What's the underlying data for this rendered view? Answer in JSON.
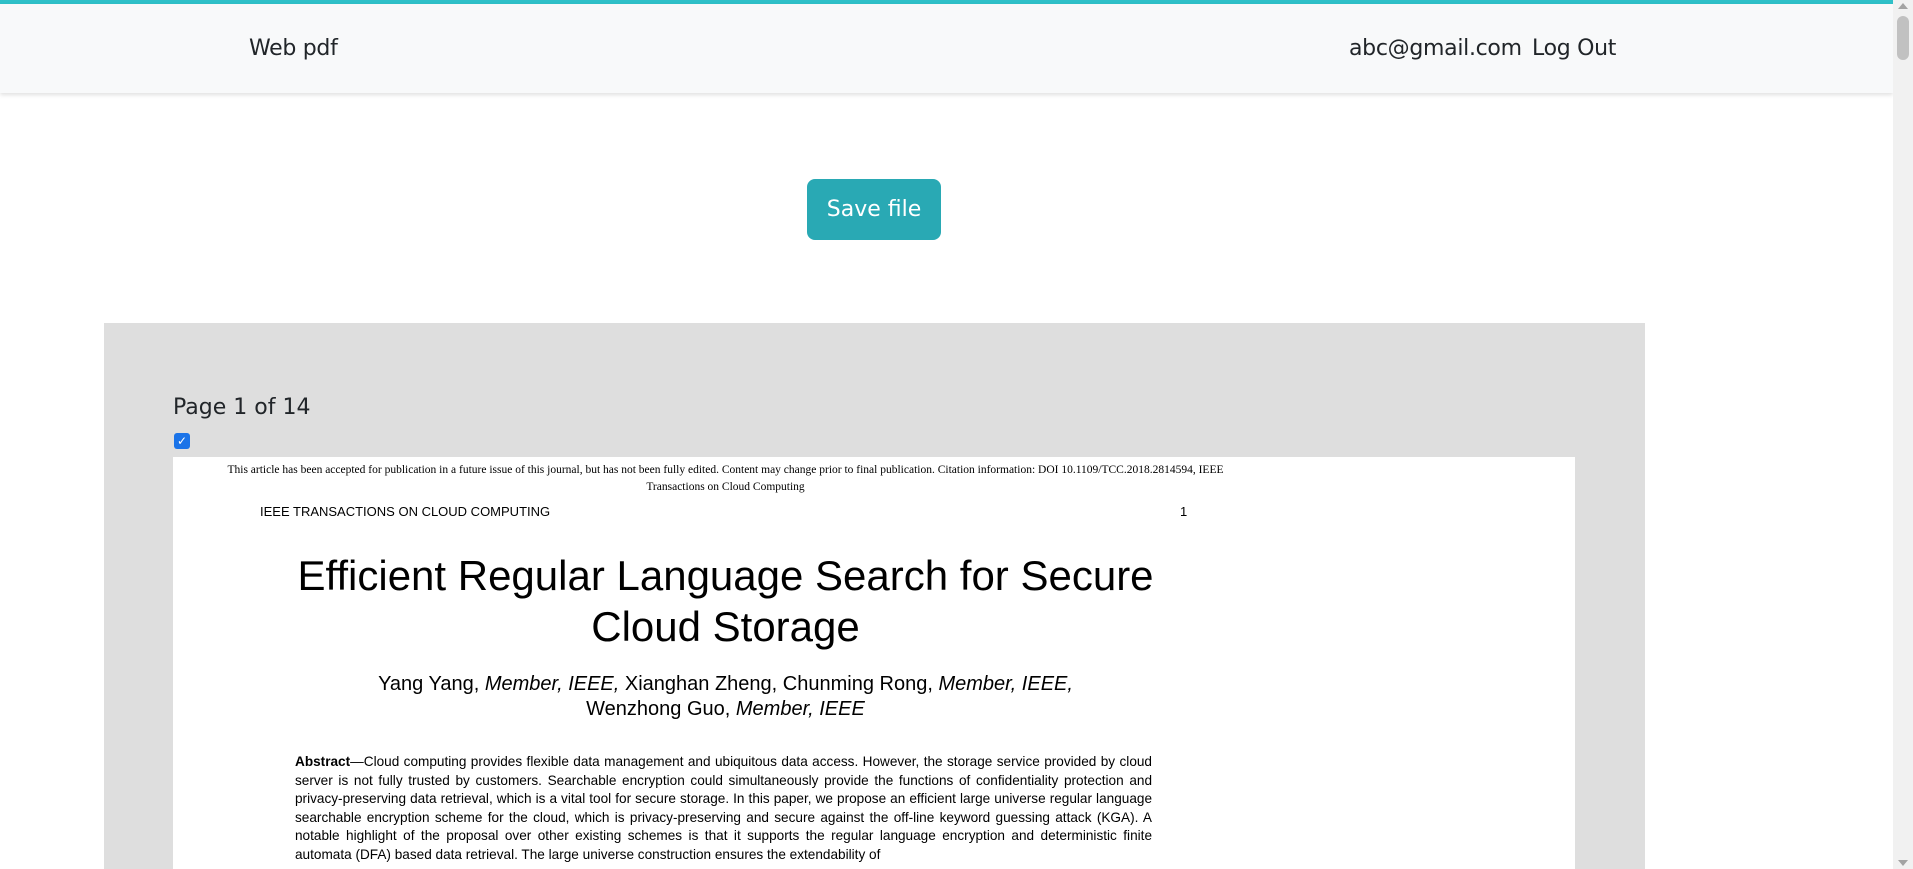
{
  "navbar": {
    "brand": "Web pdf",
    "user_email": "abc@gmail.com",
    "logout_label": "Log Out"
  },
  "actions": {
    "save_label": "Save file"
  },
  "viewer": {
    "page_indicator": "Page 1 of 14",
    "page_selected": true,
    "document": {
      "notice_line1": "This article has been accepted for publication in a future issue of this journal, but has not been fully edited. Content may change prior to final publication. Citation information: DOI 10.1109/TCC.2018.2814594, IEEE",
      "notice_line2": "Transactions on Cloud Computing",
      "journal_header": "IEEE TRANSACTIONS ON CLOUD COMPUTING",
      "page_number": "1",
      "title_line1": "Efficient Regular Language Search for Secure",
      "title_line2": "Cloud Storage",
      "authors": {
        "a1": "Yang Yang, ",
        "a1_role": "Member, IEEE,",
        "a2": " Xianghan Zheng, Chunming Rong, ",
        "a2_role": "Member, IEEE,",
        "a3": "Wenzhong Guo, ",
        "a3_role": "Member, IEEE"
      },
      "abstract_label": "Abstract",
      "abstract_text": "—Cloud computing provides flexible data management and ubiquitous data access. However, the storage service provided by cloud server is not fully trusted by customers. Searchable encryption could simultaneously provide the functions of confidentiality protection and privacy-preserving data retrieval, which is a vital tool for secure storage. In this paper, we propose an efficient large universe regular language searchable encryption scheme for the cloud, which is privacy-preserving and secure against the off-line keyword guessing attack (KGA). A notable highlight of the proposal over other existing schemes is that it supports the regular language encryption and deterministic finite automata (DFA) based data retrieval. The large universe construction ensures the extendability of"
    }
  },
  "colors": {
    "accent": "#2fc0c8",
    "button": "#29a9b4",
    "viewer_bg": "#dedede",
    "navbar_bg": "#f8f9fa"
  }
}
